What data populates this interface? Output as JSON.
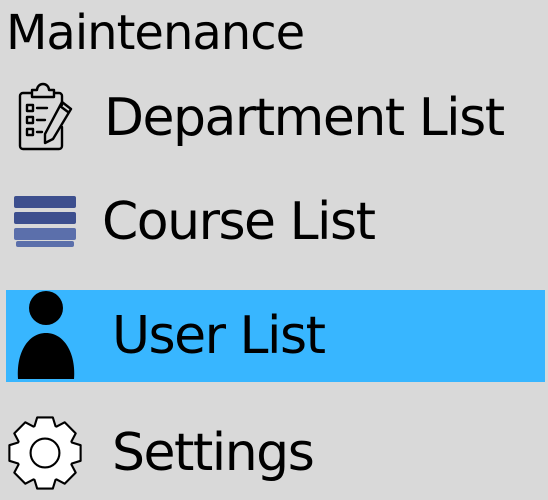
{
  "section": {
    "title": "Maintenance"
  },
  "nav": {
    "items": [
      {
        "label": "Department List",
        "icon": "clipboard-checklist-icon",
        "active": false
      },
      {
        "label": "Course List",
        "icon": "stacked-bars-icon",
        "active": false
      },
      {
        "label": "User List",
        "icon": "user-icon",
        "active": true
      },
      {
        "label": "Settings",
        "icon": "gear-icon",
        "active": false
      }
    ]
  },
  "colors": {
    "background": "#d9d9d9",
    "active_highlight": "#38b6ff",
    "course_icon_dark": "#3d4f8e",
    "course_icon_light": "#5b6fab",
    "text": "#000000"
  }
}
